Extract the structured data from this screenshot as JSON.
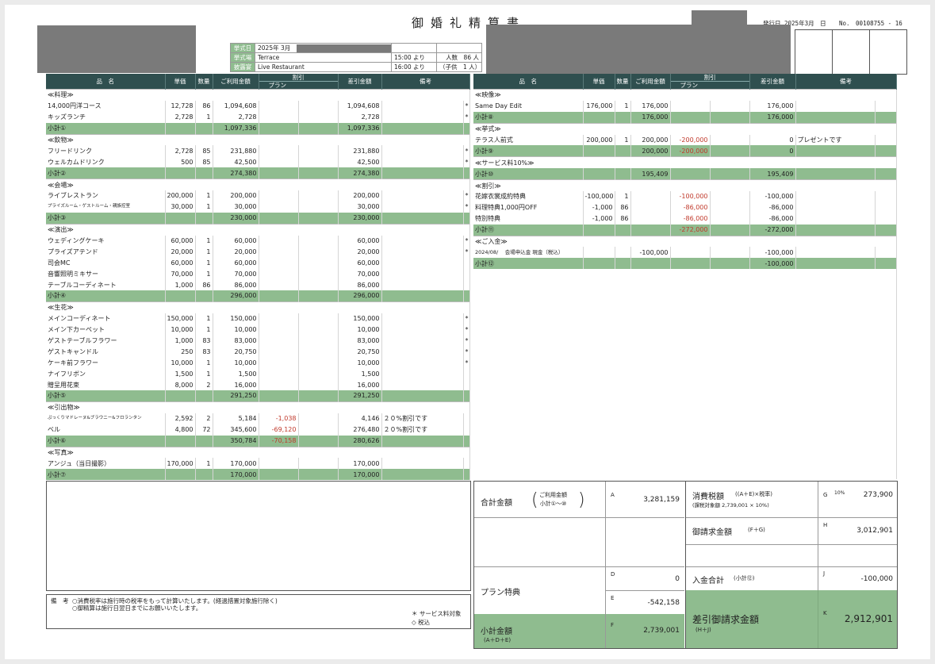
{
  "doc": {
    "title": "御婚礼精算書",
    "issue_date": "発行日 2025年3月　日",
    "number": "No.　00108755 - 16"
  },
  "info": {
    "rows": [
      {
        "label": "挙式日",
        "value": "2025年 3月",
        "time": "",
        "extra": ""
      },
      {
        "label": "挙式場",
        "value": "Terrace",
        "time": "15:00 より",
        "extra": "人数　86 人"
      },
      {
        "label": "披露宴",
        "value": "Live Restaurant",
        "time": "16:00 より",
        "extra": "（子供　1 人）"
      }
    ]
  },
  "left_headers": {
    "name": "品　名",
    "price": "単価",
    "qty": "数量",
    "amount": "ご利用金額",
    "discount": "割引",
    "plan": "プラン",
    "net": "差引金額",
    "remarks": "備考"
  },
  "left_rows": [
    {
      "t": "sec",
      "name": "≪料理≫"
    },
    {
      "t": "item",
      "name": "14,000円洋コース",
      "price": "12,728",
      "qty": "86",
      "amount": "1,094,608",
      "plan": "",
      "disc": "",
      "net": "1,094,608",
      "remarks": "",
      "star": "*"
    },
    {
      "t": "item",
      "name": "キッズランチ",
      "price": "2,728",
      "qty": "1",
      "amount": "2,728",
      "plan": "",
      "disc": "",
      "net": "2,728",
      "remarks": "",
      "star": "*"
    },
    {
      "t": "sub",
      "name": "小計①",
      "amount": "1,097,336",
      "plan": "",
      "disc": "",
      "net": "1,097,336"
    },
    {
      "t": "sec",
      "name": "≪飲物≫"
    },
    {
      "t": "item",
      "name": "フリードリンク",
      "price": "2,728",
      "qty": "85",
      "amount": "231,880",
      "plan": "",
      "disc": "",
      "net": "231,880",
      "remarks": "",
      "star": "*"
    },
    {
      "t": "item",
      "name": "ウェルカムドリンク",
      "price": "500",
      "qty": "85",
      "amount": "42,500",
      "plan": "",
      "disc": "",
      "net": "42,500",
      "remarks": "",
      "star": "*"
    },
    {
      "t": "sub",
      "name": "小計②",
      "amount": "274,380",
      "plan": "",
      "disc": "",
      "net": "274,380"
    },
    {
      "t": "sec",
      "name": "≪会場≫"
    },
    {
      "t": "item",
      "name": "ライブレストラン",
      "price": "200,000",
      "qty": "1",
      "amount": "200,000",
      "plan": "",
      "disc": "",
      "net": "200,000",
      "remarks": "",
      "star": "*"
    },
    {
      "t": "item",
      "name": "プライズルーム・ゲストルーム・親族控室",
      "small": "tiny",
      "price": "30,000",
      "qty": "1",
      "amount": "30,000",
      "plan": "",
      "disc": "",
      "net": "30,000",
      "remarks": "",
      "star": "*"
    },
    {
      "t": "sub",
      "name": "小計③",
      "amount": "230,000",
      "plan": "",
      "disc": "",
      "net": "230,000"
    },
    {
      "t": "sec",
      "name": "≪演出≫"
    },
    {
      "t": "item",
      "name": "ウェディングケーキ",
      "price": "60,000",
      "qty": "1",
      "amount": "60,000",
      "plan": "",
      "disc": "",
      "net": "60,000",
      "remarks": "",
      "star": "*"
    },
    {
      "t": "item",
      "name": "プライズアテンド",
      "price": "20,000",
      "qty": "1",
      "amount": "20,000",
      "plan": "",
      "disc": "",
      "net": "20,000",
      "remarks": "",
      "star": "*"
    },
    {
      "t": "item",
      "name": "司会MC",
      "price": "60,000",
      "qty": "1",
      "amount": "60,000",
      "plan": "",
      "disc": "",
      "net": "60,000",
      "remarks": "",
      "star": ""
    },
    {
      "t": "item",
      "name": "音響照明ミキサー",
      "price": "70,000",
      "qty": "1",
      "amount": "70,000",
      "plan": "",
      "disc": "",
      "net": "70,000",
      "remarks": "",
      "star": ""
    },
    {
      "t": "item",
      "name": "テーブルコーディネート",
      "price": "1,000",
      "qty": "86",
      "amount": "86,000",
      "plan": "",
      "disc": "",
      "net": "86,000",
      "remarks": "",
      "star": ""
    },
    {
      "t": "sub",
      "name": "小計④",
      "amount": "296,000",
      "plan": "",
      "disc": "",
      "net": "296,000"
    },
    {
      "t": "sec",
      "name": "≪生花≫"
    },
    {
      "t": "item",
      "name": "メインコーディネート",
      "price": "150,000",
      "qty": "1",
      "amount": "150,000",
      "plan": "",
      "disc": "",
      "net": "150,000",
      "remarks": "",
      "star": "*"
    },
    {
      "t": "item",
      "name": "メイン下カーペット",
      "price": "10,000",
      "qty": "1",
      "amount": "10,000",
      "plan": "",
      "disc": "",
      "net": "10,000",
      "remarks": "",
      "star": "*"
    },
    {
      "t": "item",
      "name": "ゲストテーブルフラワー",
      "price": "1,000",
      "qty": "83",
      "amount": "83,000",
      "plan": "",
      "disc": "",
      "net": "83,000",
      "remarks": "",
      "star": "*"
    },
    {
      "t": "item",
      "name": "ゲストキャンドル",
      "price": "250",
      "qty": "83",
      "amount": "20,750",
      "plan": "",
      "disc": "",
      "net": "20,750",
      "remarks": "",
      "star": "*"
    },
    {
      "t": "item",
      "name": "ケーキ前フラワー",
      "price": "10,000",
      "qty": "1",
      "amount": "10,000",
      "plan": "",
      "disc": "",
      "net": "10,000",
      "remarks": "",
      "star": "*"
    },
    {
      "t": "item",
      "name": "ナイフリボン",
      "price": "1,500",
      "qty": "1",
      "amount": "1,500",
      "plan": "",
      "disc": "",
      "net": "1,500",
      "remarks": "",
      "star": ""
    },
    {
      "t": "item",
      "name": "贈呈用花束",
      "price": "8,000",
      "qty": "2",
      "amount": "16,000",
      "plan": "",
      "disc": "",
      "net": "16,000",
      "remarks": "",
      "star": ""
    },
    {
      "t": "sub",
      "name": "小計⑤",
      "amount": "291,250",
      "plan": "",
      "disc": "",
      "net": "291,250"
    },
    {
      "t": "sec",
      "name": "≪引出物≫"
    },
    {
      "t": "item",
      "name": "ぷっくりマドレーヌ&ブラウニー&フロランタン",
      "small": "tiny",
      "price": "2,592",
      "qty": "2",
      "amount": "5,184",
      "plan": "-1,038",
      "disc": "",
      "net": "4,146",
      "remarks": "２０%割引です",
      "star": ""
    },
    {
      "t": "item",
      "name": "ベル",
      "price": "4,800",
      "qty": "72",
      "amount": "345,600",
      "plan": "-69,120",
      "disc": "",
      "net": "276,480",
      "remarks": "２０%割引です",
      "star": ""
    },
    {
      "t": "sub",
      "name": "小計⑥",
      "amount": "350,784",
      "plan": "-70,158",
      "disc": "",
      "net": "280,626"
    },
    {
      "t": "sec",
      "name": "≪写真≫"
    },
    {
      "t": "item",
      "name": "アンジュ（当日撮影）",
      "price": "170,000",
      "qty": "1",
      "amount": "170,000",
      "plan": "",
      "disc": "",
      "net": "170,000",
      "remarks": "",
      "star": ""
    },
    {
      "t": "sub",
      "name": "小計⑦",
      "amount": "170,000",
      "plan": "",
      "disc": "",
      "net": "170,000"
    }
  ],
  "right_rows": [
    {
      "t": "sec",
      "name": "≪映像≫"
    },
    {
      "t": "item",
      "name": "Same Day Edit",
      "price": "176,000",
      "qty": "1",
      "amount": "176,000",
      "plan": "",
      "disc": "",
      "net": "176,000",
      "remarks": ""
    },
    {
      "t": "sub",
      "name": "小計⑧",
      "amount": "176,000",
      "plan": "",
      "disc": "",
      "net": "176,000"
    },
    {
      "t": "sec",
      "name": "≪挙式≫"
    },
    {
      "t": "item",
      "name": "テラス人前式",
      "price": "200,000",
      "qty": "1",
      "amount": "200,000",
      "plan": "-200,000",
      "disc": "",
      "net": "0",
      "remarks": "プレゼントです"
    },
    {
      "t": "sub",
      "name": "小計⑨",
      "amount": "200,000",
      "plan": "-200,000",
      "disc": "",
      "net": "0"
    },
    {
      "t": "sec",
      "name": "≪サービス料10%≫"
    },
    {
      "t": "sub",
      "name": "小計⑩",
      "amount": "195,409",
      "plan": "",
      "disc": "",
      "net": "195,409"
    },
    {
      "t": "sec",
      "name": "≪割引≫"
    },
    {
      "t": "item",
      "name": "花嫁衣裳成約特典",
      "price": "-100,000",
      "qty": "1",
      "amount": "",
      "plan": "-100,000",
      "disc": "",
      "net": "-100,000",
      "remarks": ""
    },
    {
      "t": "item",
      "name": "料理特典1,000円OFF",
      "price": "-1,000",
      "qty": "86",
      "amount": "",
      "plan": "-86,000",
      "disc": "",
      "net": "-86,000",
      "remarks": ""
    },
    {
      "t": "item",
      "name": "特別特典",
      "price": "-1,000",
      "qty": "86",
      "amount": "",
      "plan": "-86,000",
      "disc": "",
      "net": "-86,000",
      "remarks": ""
    },
    {
      "t": "sub",
      "name": "小計⑪",
      "amount": "",
      "plan": "-272,000",
      "disc": "",
      "net": "-272,000"
    },
    {
      "t": "sec",
      "name": "≪ご入金≫"
    },
    {
      "t": "item",
      "name": "2024/08/　 会場申込金 現金（税込）",
      "small": "tiny7",
      "price": "",
      "qty": "",
      "amount": "-100,000",
      "plan": "",
      "disc": "",
      "net": "-100,000",
      "remarks": ""
    },
    {
      "t": "sub",
      "name": "小計⑫",
      "amount": "",
      "plan": "",
      "disc": "",
      "net": "-100,000"
    }
  ],
  "summary": {
    "total_label": "合計金額",
    "total_note1": "ご利用金額",
    "total_note2": "小計①～⑩",
    "A_label": "A",
    "A": "3,281,159",
    "plan_label": "プラン特典",
    "D_label": "D",
    "D": "0",
    "E_label": "E",
    "E": "-542,158",
    "subtotal_label": "小計金額",
    "subtotal_formula": "(A＋D＋E)",
    "F_label": "F",
    "F": "2,739,001",
    "tax_label": "消費税額",
    "tax_formula": "((A＋E)×税率)",
    "tax_base": "(課税対象額 2,739,001 × 10%)",
    "G_label": "G",
    "G_rate": "10%",
    "G": "273,900",
    "bill_label": "御請求金額",
    "bill_formula": "(F＋G)",
    "H_label": "H",
    "H": "3,012,901",
    "paid_label": "入金合計",
    "paid_note": "(小計⑫)",
    "J_label": "J",
    "J": "-100,000",
    "final_label": "差引御請求金額",
    "final_formula": "(H＋J)",
    "K_label": "K",
    "K": "2,912,901"
  },
  "notes": {
    "label": "備　考",
    "line1": "○消費税率は施行時の税率をもって計算いたします。(経過措置対象施行除く)",
    "line2": "○御精算は施行日翌日までにお願いいたします。",
    "legend1": "＊ サービス料対象",
    "legend2": "◇ 税込"
  },
  "colors": {
    "header": "#2f4f4f",
    "subtotal": "#8fbc8f",
    "negative": "#c0392b"
  }
}
